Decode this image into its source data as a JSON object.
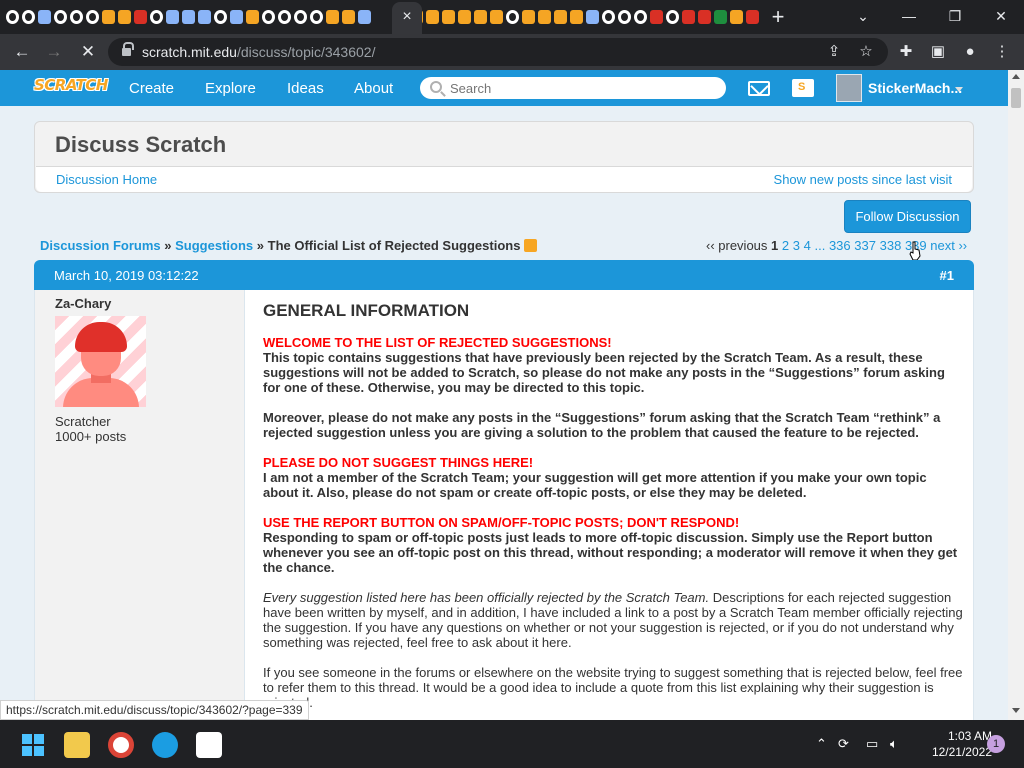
{
  "browser": {
    "url_host": "scratch.mit.edu",
    "url_path": "/discuss/topic/343602/",
    "status_url": "https://scratch.mit.edu/discuss/topic/343602/?page=339",
    "tab_close": "×",
    "new_tab": "+"
  },
  "nav": {
    "logo": "SCRATCH",
    "items": [
      "Create",
      "Explore",
      "Ideas",
      "About"
    ],
    "search_placeholder": "Search",
    "username": "StickerMach..."
  },
  "header": {
    "title": "Discuss Scratch",
    "home_link": "Discussion Home",
    "new_posts_link": "Show new posts since last visit"
  },
  "follow_button": "Follow Discussion",
  "breadcrumb": {
    "forums": "Discussion Forums",
    "sep": "»",
    "category": "Suggestions",
    "topic": "The Official List of Rejected Suggestions"
  },
  "pagination": {
    "prev": "‹‹ previous",
    "current": "1",
    "pages": [
      "2",
      "3",
      "4"
    ],
    "ellipsis": "...",
    "last_pages": [
      "336",
      "337",
      "338",
      "339"
    ],
    "next": "next ››"
  },
  "post": {
    "date": "March 10, 2019 03:12:22",
    "number": "#1",
    "author": "Za-Chary",
    "rank": "Scratcher",
    "posts": "1000+ posts",
    "heading": "GENERAL INFORMATION",
    "h1": "WELCOME TO THE LIST OF REJECTED SUGGESTIONS!",
    "p1": "This topic contains suggestions that have previously been rejected by the Scratch Team.  As a result, these suggestions will not be added to Scratch, so please do not make any posts in the “Suggestions” forum asking for one of these.  Otherwise, you may be directed to this topic.",
    "p2": "Moreover, please do not make any posts in the “Suggestions” forum asking that the Scratch Team “rethink” a rejected suggestion unless you are giving a solution to the problem that caused the feature to be rejected.",
    "h2": "PLEASE DO NOT SUGGEST THINGS HERE!",
    "p3": "I am not a member of the Scratch Team; your suggestion will get more attention if you make your own topic about it.  Also, please do not spam or create off-topic posts, or else they may be deleted.",
    "h3": "USE THE REPORT BUTTON ON SPAM/OFF-TOPIC POSTS; DON'T RESPOND!",
    "p4": "Responding to spam or off-topic posts just leads to more off-topic discussion.  Simply use the Report button whenever you see an off-topic post on this thread, without responding; a moderator will remove it when they get the chance.",
    "p5_italic": "Every suggestion listed here has been officially rejected by the Scratch Team.",
    "p5_rest": "  Descriptions for each rejected suggestion have been written by myself, and in addition, I have included a link to a post by a Scratch Team member officially rejecting the suggestion.  If you have any questions on whether or not your suggestion is rejected, or if you do not understand why something was rejected, feel free to ask about it here.",
    "p6": "If you see someone in the forums or elsewhere on the website trying to suggest something that is rejected below, feel free to refer them to this thread.  It would be a good idea to include a quote from this list explaining why their suggestion is rejected."
  },
  "taskbar": {
    "time": "1:03 AM",
    "date": "12/21/2022",
    "notifications": "1"
  },
  "colors": {
    "scratch_blue": "#1c96d9",
    "red_heading": "#ff0000",
    "tab_bg": "#202124",
    "toolbar_bg": "#35363a"
  }
}
